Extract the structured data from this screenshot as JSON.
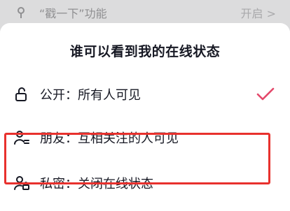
{
  "background": {
    "label": "“戳一下”功能",
    "value": "开启 >"
  },
  "sheet": {
    "title": "谁可以看到我的在线状态",
    "options": [
      {
        "label": "公开：所有人可见",
        "icon": "unlock-icon",
        "selected": true
      },
      {
        "label": "朋友：互相关注的人可见",
        "icon": "friends-icon",
        "selected": false
      },
      {
        "label": "私密：关闭在线状态",
        "icon": "private-user-lock-icon",
        "selected": false
      }
    ]
  },
  "colors": {
    "check": "#e4496b",
    "highlight": "#e8312d",
    "text": "#161823"
  }
}
